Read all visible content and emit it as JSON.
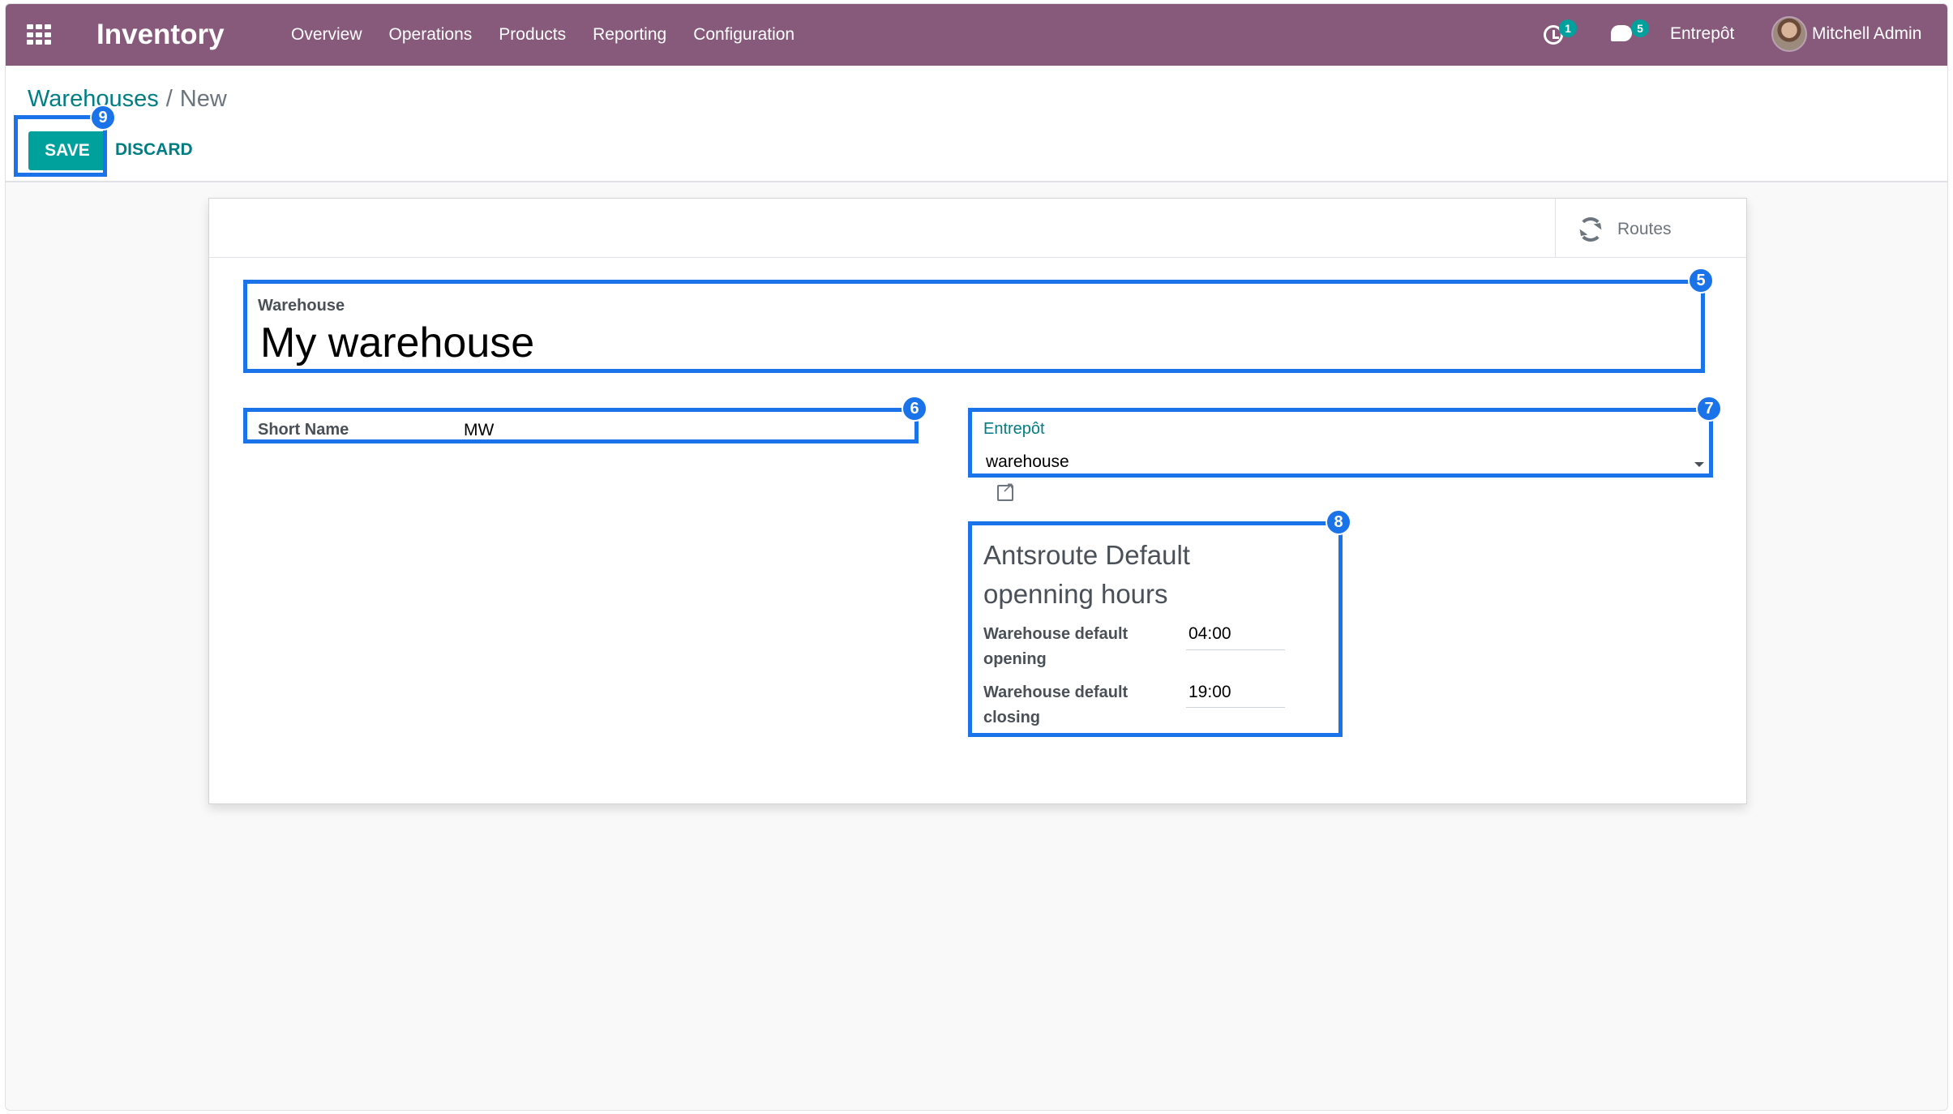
{
  "navbar": {
    "app_title": "Inventory",
    "menu": [
      "Overview",
      "Operations",
      "Products",
      "Reporting",
      "Configuration"
    ],
    "activity_count": "1",
    "message_count": "5",
    "company": "Entrepôt",
    "user": "Mitchell Admin"
  },
  "breadcrumb": {
    "parent": "Warehouses",
    "separator": "/",
    "current": "New"
  },
  "actions": {
    "save": "SAVE",
    "discard": "DISCARD"
  },
  "button_box": {
    "routes": "Routes"
  },
  "form": {
    "warehouse_label": "Warehouse",
    "warehouse_name": "My warehouse",
    "short_name_label": "Short Name",
    "short_name_value": "MW",
    "entrepot_label": "Entrepôt",
    "entrepot_value": "warehouse",
    "group_title": "Antsroute Default openning hours",
    "opening_label": "Warehouse default opening",
    "opening_value": "04:00",
    "closing_label": "Warehouse default closing",
    "closing_value": "19:00"
  },
  "annotations": [
    "5",
    "6",
    "7",
    "8",
    "9"
  ],
  "colors": {
    "navbar": "#875a7b",
    "primary": "#00a09d",
    "link": "#017e84",
    "highlight": "#1a73e8"
  }
}
